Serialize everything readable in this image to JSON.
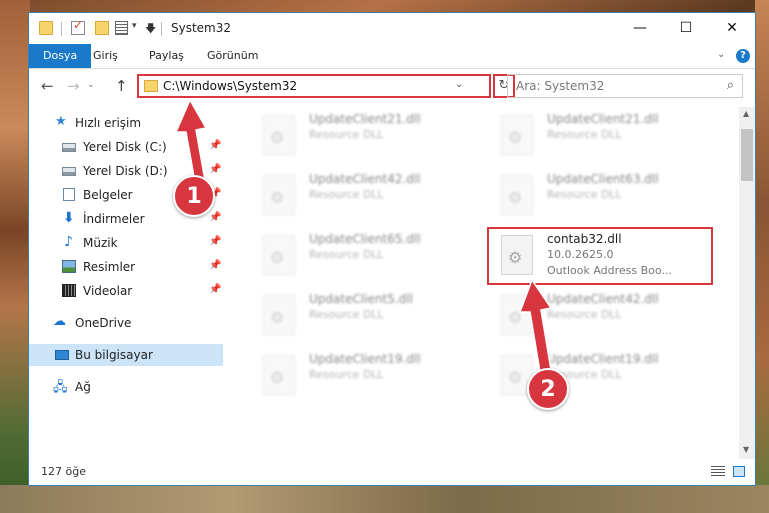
{
  "window": {
    "title": "System32",
    "controls": {
      "minimize": "—",
      "maximize": "☐",
      "close": "✕"
    }
  },
  "ribbon": {
    "tabs": [
      {
        "label": "Dosya"
      },
      {
        "label": "Giriş"
      },
      {
        "label": "Paylaş"
      },
      {
        "label": "Görünüm"
      }
    ],
    "help": "?"
  },
  "navigation": {
    "address": "C:\\Windows\\System32",
    "search_placeholder": "Ara: System32"
  },
  "sidebar": {
    "quick_access": "Hızlı erişim",
    "items": [
      {
        "label": "Yerel Disk (C:)",
        "icon": "drive-icon",
        "pinned": true
      },
      {
        "label": "Yerel Disk (D:)",
        "icon": "drive-icon",
        "pinned": true
      },
      {
        "label": "Belgeler",
        "icon": "documents-icon",
        "pinned": true
      },
      {
        "label": "İndirmeler",
        "icon": "downloads-icon",
        "pinned": true
      },
      {
        "label": "Müzik",
        "icon": "music-icon",
        "pinned": true
      },
      {
        "label": "Resimler",
        "icon": "pictures-icon",
        "pinned": true
      },
      {
        "label": "Videolar",
        "icon": "videos-icon",
        "pinned": true
      }
    ],
    "onedrive": "OneDrive",
    "this_pc": "Bu bilgisayar",
    "network": "Ağ"
  },
  "files": [
    {
      "name": "UpdateClient21.dll",
      "type": "Resource DLL",
      "blurred": true
    },
    {
      "name": "UpdateClient21.dll",
      "type": "Resource DLL",
      "blurred": true
    },
    {
      "name": "UpdateClient42.dll",
      "type": "Resource DLL",
      "blurred": true
    },
    {
      "name": "UpdateClient63.dll",
      "type": "Resource DLL",
      "blurred": true
    },
    {
      "name": "UpdateClient65.dll",
      "type": "Resource DLL",
      "blurred": true
    },
    {
      "name": "contab32.dll",
      "type": "10.0.2625.0",
      "description": "Outlook Address Boo...",
      "blurred": false,
      "highlighted": true
    },
    {
      "name": "UpdateClient5.dll",
      "type": "Resource DLL",
      "blurred": true
    },
    {
      "name": "UpdateClient42.dll",
      "type": "Resource DLL",
      "blurred": true
    },
    {
      "name": "UpdateClient19.dll",
      "type": "Resource DLL",
      "blurred": true
    },
    {
      "name": "UpdateClient19.dll",
      "type": "Resource DLL",
      "blurred": true
    }
  ],
  "status": {
    "item_count": "127 öğe"
  },
  "annotations": {
    "step1": "1",
    "step2": "2",
    "color": "#d7363f"
  }
}
